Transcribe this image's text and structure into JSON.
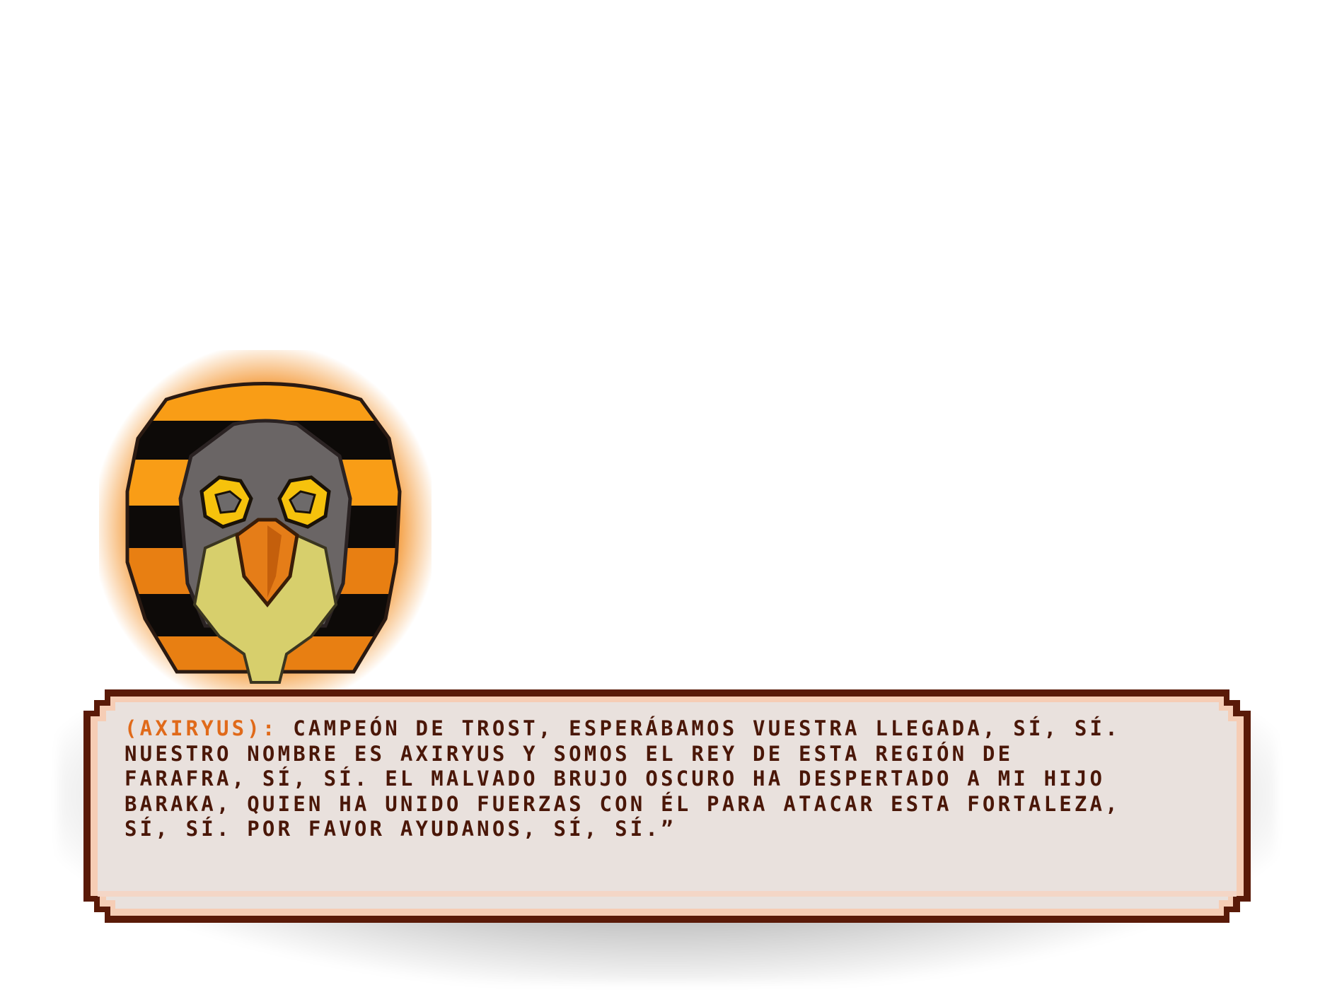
{
  "dialog": {
    "speaker": "(AXIRYUS):",
    "lines": [
      " CAMPEÓN DE TROST, ESPERÁBAMOS VUESTRA LLEGADA, SÍ, SÍ.",
      "NUESTRO NOMBRE ES AXIRYUS Y SOMOS EL REY DE ESTA REGIÓN DE",
      "FARAFRA, SÍ, SÍ. EL MALVADO BRUJO OSCURO HA DESPERTADO A MI HIJO",
      "BARAKA, QUIEN HA UNIDO FUERZAS CON ÉL PARA ATACAR ESTA FORTALEZA,",
      "SÍ, SÍ. POR FAVOR AYUDANOS, SÍ, SÍ.”"
    ]
  },
  "portrait": {
    "character_icon": "bird-mask-portrait-icon"
  },
  "colors": {
    "speaker": "#e06a1a",
    "text": "#4a1708",
    "box_border": "#5a1a08",
    "box_fill": "#e9e1dd",
    "box_highlight": "#f6cdb5",
    "glow": "#f28a1a",
    "stripe_orange": "#f99d16",
    "stripe_black": "#0d0a08",
    "mask_gray": "#6a6565",
    "eye_yellow": "#f6c20c",
    "beak_orange": "#e57d18",
    "chest_yellow": "#d7cf6c"
  }
}
